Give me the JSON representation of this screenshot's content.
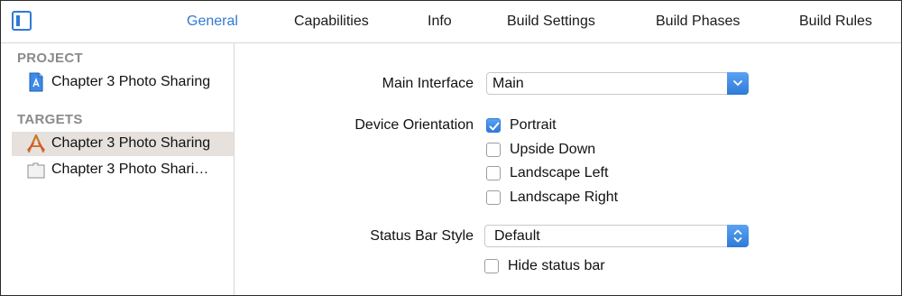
{
  "tabs": [
    {
      "label": "General",
      "active": true
    },
    {
      "label": "Capabilities",
      "active": false
    },
    {
      "label": "Info",
      "active": false
    },
    {
      "label": "Build Settings",
      "active": false
    },
    {
      "label": "Build Phases",
      "active": false
    },
    {
      "label": "Build Rules",
      "active": false
    }
  ],
  "sidebar": {
    "project_header": "PROJECT",
    "project_item": "Chapter 3 Photo Sharing",
    "targets_header": "TARGETS",
    "targets": [
      {
        "label": "Chapter 3 Photo Sharing",
        "selected": true,
        "icon": "app-target-icon"
      },
      {
        "label": "Chapter 3 Photo Shari…",
        "selected": false,
        "icon": "test-bundle-icon"
      }
    ]
  },
  "main": {
    "main_interface_label": "Main Interface",
    "main_interface_value": "Main",
    "device_orientation_label": "Device Orientation",
    "orientations": [
      {
        "label": "Portrait",
        "checked": true
      },
      {
        "label": "Upside Down",
        "checked": false
      },
      {
        "label": "Landscape Left",
        "checked": false
      },
      {
        "label": "Landscape Right",
        "checked": false
      }
    ],
    "status_bar_style_label": "Status Bar Style",
    "status_bar_style_value": "Default",
    "hide_status_bar_label": "Hide status bar",
    "hide_status_bar_checked": false
  },
  "colors": {
    "accent": "#2f7ad6",
    "selected_row": "#e6e1dd",
    "section_header": "#8a8a8a"
  }
}
